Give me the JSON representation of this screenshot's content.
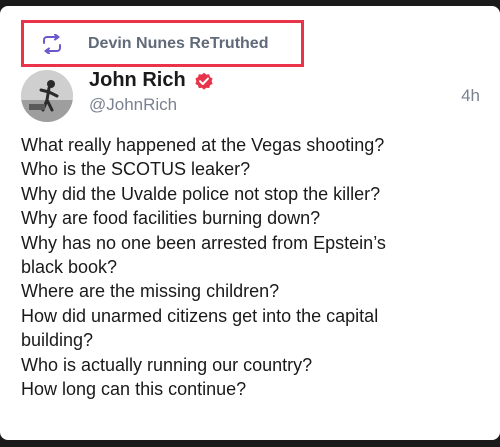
{
  "retruth": {
    "label": "Devin Nunes ReTruthed",
    "icon": "retruth-icon",
    "highlight_color": "#e8334a"
  },
  "post": {
    "author_name": "John Rich",
    "author_handle": "@JohnRich",
    "verified_icon": "verified-badge-icon",
    "verified_color": "#e8334a",
    "time": "4h",
    "lines": [
      "What really happened at the Vegas shooting?",
      "Who is the SCOTUS leaker?",
      "Why did the Uvalde police not stop the killer?",
      "Why are food facilities burning down?",
      "Why has no one been arrested from Epstein’s",
      "black book?",
      "Where are the missing children?",
      "How did unarmed citizens get into the capital",
      "building?",
      "Who is actually running our country?",
      "How long can this continue?"
    ]
  }
}
